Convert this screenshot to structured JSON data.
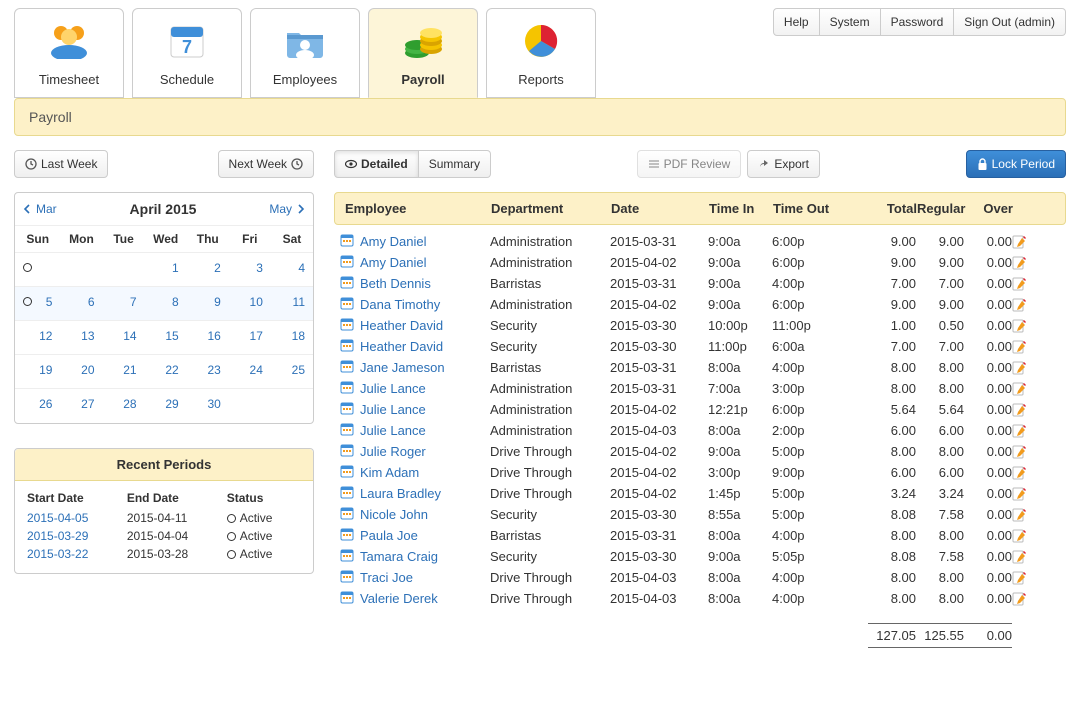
{
  "top": {
    "tabs": [
      {
        "label": "Timesheet"
      },
      {
        "label": "Schedule"
      },
      {
        "label": "Employees"
      },
      {
        "label": "Payroll"
      },
      {
        "label": "Reports"
      }
    ],
    "active_tab": "Payroll",
    "buttons": {
      "help": "Help",
      "system": "System",
      "password": "Password",
      "signout": "Sign Out (admin)"
    }
  },
  "titlebar": "Payroll",
  "left": {
    "last_week": "Last Week",
    "next_week": "Next Week",
    "cal": {
      "prev": "Mar",
      "title": "April 2015",
      "next": "May",
      "dow": [
        "Sun",
        "Mon",
        "Tue",
        "Wed",
        "Thu",
        "Fri",
        "Sat"
      ],
      "weeks": [
        [
          {
            "n": ""
          },
          {
            "n": ""
          },
          {
            "n": ""
          },
          {
            "n": "1"
          },
          {
            "n": "2"
          },
          {
            "n": "3"
          },
          {
            "n": "4"
          }
        ],
        [
          {
            "n": "5"
          },
          {
            "n": "6"
          },
          {
            "n": "7"
          },
          {
            "n": "8"
          },
          {
            "n": "9"
          },
          {
            "n": "10"
          },
          {
            "n": "11"
          }
        ],
        [
          {
            "n": "12"
          },
          {
            "n": "13"
          },
          {
            "n": "14"
          },
          {
            "n": "15"
          },
          {
            "n": "16"
          },
          {
            "n": "17"
          },
          {
            "n": "18"
          }
        ],
        [
          {
            "n": "19"
          },
          {
            "n": "20"
          },
          {
            "n": "21"
          },
          {
            "n": "22"
          },
          {
            "n": "23"
          },
          {
            "n": "24"
          },
          {
            "n": "25"
          }
        ],
        [
          {
            "n": "26"
          },
          {
            "n": "27"
          },
          {
            "n": "28"
          },
          {
            "n": "29"
          },
          {
            "n": "30"
          },
          {
            "n": ""
          },
          {
            "n": ""
          }
        ]
      ],
      "ring_rows": [
        0,
        1
      ]
    },
    "recent": {
      "title": "Recent Periods",
      "cols": {
        "start": "Start Date",
        "end": "End Date",
        "status": "Status"
      },
      "rows": [
        {
          "start": "2015-04-05",
          "end": "2015-04-11",
          "status": "Active"
        },
        {
          "start": "2015-03-29",
          "end": "2015-04-04",
          "status": "Active"
        },
        {
          "start": "2015-03-22",
          "end": "2015-03-28",
          "status": "Active"
        }
      ]
    }
  },
  "right": {
    "toolbar": {
      "detailed": "Detailed",
      "summary": "Summary",
      "pdf": "PDF Review",
      "export": "Export",
      "lock": "Lock Period"
    },
    "cols": {
      "emp": "Employee",
      "dept": "Department",
      "date": "Date",
      "in": "Time In",
      "out": "Time Out",
      "total": "Total",
      "regular": "Regular",
      "over": "Over"
    },
    "rows": [
      {
        "emp": "Amy Daniel",
        "dept": "Administration",
        "date": "2015-03-31",
        "in": "9:00a",
        "out": "6:00p",
        "total": "9.00",
        "reg": "9.00",
        "over": "0.00"
      },
      {
        "emp": "Amy Daniel",
        "dept": "Administration",
        "date": "2015-04-02",
        "in": "9:00a",
        "out": "6:00p",
        "total": "9.00",
        "reg": "9.00",
        "over": "0.00"
      },
      {
        "emp": "Beth Dennis",
        "dept": "Barristas",
        "date": "2015-03-31",
        "in": "9:00a",
        "out": "4:00p",
        "total": "7.00",
        "reg": "7.00",
        "over": "0.00"
      },
      {
        "emp": "Dana Timothy",
        "dept": "Administration",
        "date": "2015-04-02",
        "in": "9:00a",
        "out": "6:00p",
        "total": "9.00",
        "reg": "9.00",
        "over": "0.00"
      },
      {
        "emp": "Heather David",
        "dept": "Security",
        "date": "2015-03-30",
        "in": "10:00p",
        "out": "11:00p",
        "total": "1.00",
        "reg": "0.50",
        "over": "0.00"
      },
      {
        "emp": "Heather David",
        "dept": "Security",
        "date": "2015-03-30",
        "in": "11:00p",
        "out": "6:00a",
        "total": "7.00",
        "reg": "7.00",
        "over": "0.00"
      },
      {
        "emp": "Jane Jameson",
        "dept": "Barristas",
        "date": "2015-03-31",
        "in": "8:00a",
        "out": "4:00p",
        "total": "8.00",
        "reg": "8.00",
        "over": "0.00"
      },
      {
        "emp": "Julie Lance",
        "dept": "Administration",
        "date": "2015-03-31",
        "in": "7:00a",
        "out": "3:00p",
        "total": "8.00",
        "reg": "8.00",
        "over": "0.00"
      },
      {
        "emp": "Julie Lance",
        "dept": "Administration",
        "date": "2015-04-02",
        "in": "12:21p",
        "out": "6:00p",
        "total": "5.64",
        "reg": "5.64",
        "over": "0.00"
      },
      {
        "emp": "Julie Lance",
        "dept": "Administration",
        "date": "2015-04-03",
        "in": "8:00a",
        "out": "2:00p",
        "total": "6.00",
        "reg": "6.00",
        "over": "0.00"
      },
      {
        "emp": "Julie Roger",
        "dept": "Drive Through",
        "date": "2015-04-02",
        "in": "9:00a",
        "out": "5:00p",
        "total": "8.00",
        "reg": "8.00",
        "over": "0.00"
      },
      {
        "emp": "Kim Adam",
        "dept": "Drive Through",
        "date": "2015-04-02",
        "in": "3:00p",
        "out": "9:00p",
        "total": "6.00",
        "reg": "6.00",
        "over": "0.00"
      },
      {
        "emp": "Laura Bradley",
        "dept": "Drive Through",
        "date": "2015-04-02",
        "in": "1:45p",
        "out": "5:00p",
        "total": "3.24",
        "reg": "3.24",
        "over": "0.00"
      },
      {
        "emp": "Nicole John",
        "dept": "Security",
        "date": "2015-03-30",
        "in": "8:55a",
        "out": "5:00p",
        "total": "8.08",
        "reg": "7.58",
        "over": "0.00"
      },
      {
        "emp": "Paula Joe",
        "dept": "Barristas",
        "date": "2015-03-31",
        "in": "8:00a",
        "out": "4:00p",
        "total": "8.00",
        "reg": "8.00",
        "over": "0.00"
      },
      {
        "emp": "Tamara Craig",
        "dept": "Security",
        "date": "2015-03-30",
        "in": "9:00a",
        "out": "5:05p",
        "total": "8.08",
        "reg": "7.58",
        "over": "0.00"
      },
      {
        "emp": "Traci Joe",
        "dept": "Drive Through",
        "date": "2015-04-03",
        "in": "8:00a",
        "out": "4:00p",
        "total": "8.00",
        "reg": "8.00",
        "over": "0.00"
      },
      {
        "emp": "Valerie Derek",
        "dept": "Drive Through",
        "date": "2015-04-03",
        "in": "8:00a",
        "out": "4:00p",
        "total": "8.00",
        "reg": "8.00",
        "over": "0.00"
      }
    ],
    "totals": {
      "total": "127.05",
      "reg": "125.55",
      "over": "0.00"
    }
  }
}
